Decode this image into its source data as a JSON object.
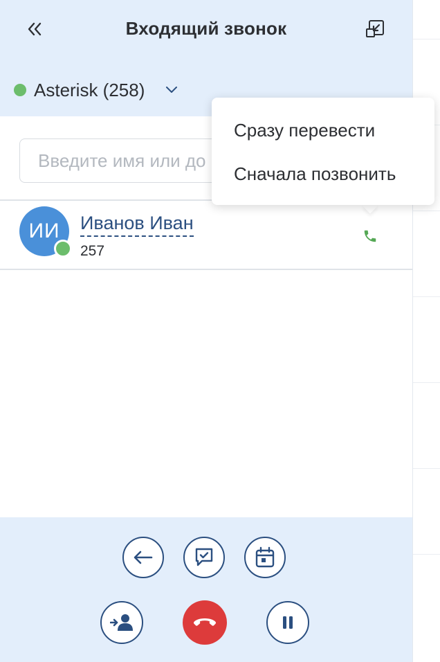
{
  "header": {
    "title": "Входящий звонок",
    "collapse_icon": "double-chevron-left-icon",
    "minimize_icon": "minimize-window-icon"
  },
  "account": {
    "label": "Asterisk (258)",
    "status_color": "#6cbd6c",
    "icon": "chevron-down-icon"
  },
  "search": {
    "placeholder": "Введите имя или до"
  },
  "contacts": [
    {
      "initials": "ИИ",
      "name": "Иванов Иван",
      "extension": "257",
      "status_color": "#6cbd6c",
      "avatar_color": "#4a90d9",
      "action_icon": "phone-icon"
    }
  ],
  "transfer_menu": {
    "items": [
      {
        "label": "Сразу перевести"
      },
      {
        "label": "Сначала позвонить"
      }
    ]
  },
  "footer": {
    "row1": [
      {
        "name": "back-button",
        "icon": "arrow-left-icon"
      },
      {
        "name": "comment-button",
        "icon": "chat-check-icon"
      },
      {
        "name": "calendar-button",
        "icon": "calendar-icon"
      }
    ],
    "row2": [
      {
        "name": "transfer-button",
        "icon": "user-transfer-icon"
      },
      {
        "name": "end-call-button",
        "icon": "hang-up-icon",
        "color": "#dd3b3b"
      },
      {
        "name": "hold-button",
        "icon": "pause-icon"
      }
    ]
  },
  "colors": {
    "header_bg": "#e3eefb",
    "accent": "#2b4f80",
    "online": "#6cbd6c",
    "end_call": "#dd3b3b"
  }
}
